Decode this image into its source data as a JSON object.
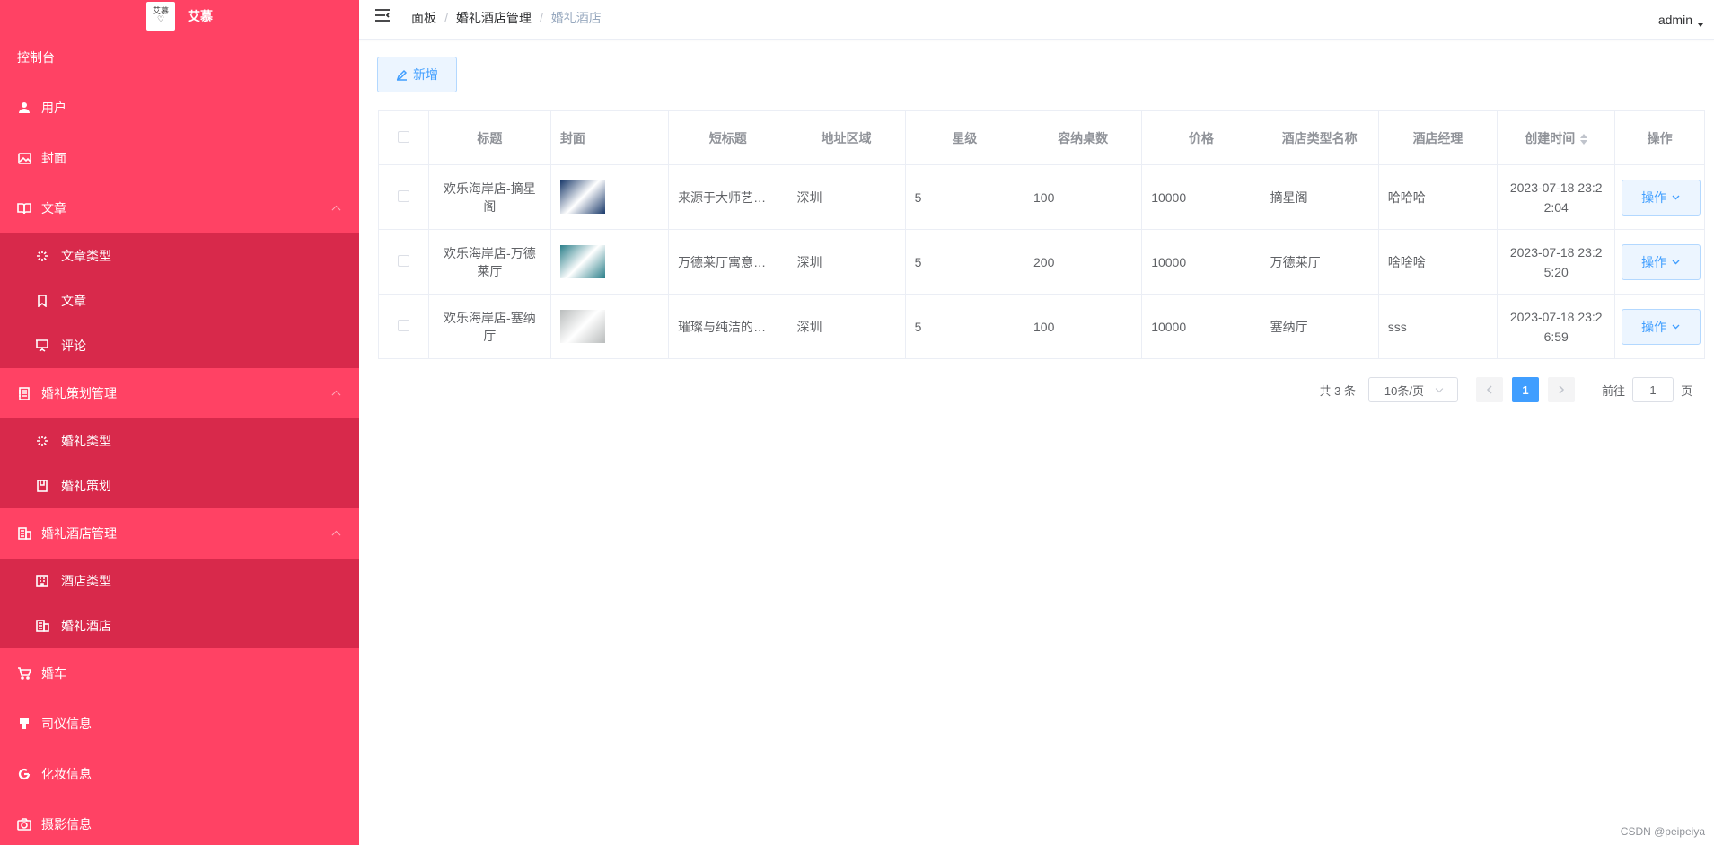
{
  "sidebar": {
    "logo_text": "艾慕",
    "logo_img_text": "艾慕 Aimu bride",
    "menu": {
      "dashboard": "控制台",
      "user": "用户",
      "cover": "封面",
      "article": "文章",
      "article_type": "文章类型",
      "article_sub": "文章",
      "comment": "评论",
      "wedding_plan_mgmt": "婚礼策划管理",
      "wedding_type": "婚礼类型",
      "wedding_plan": "婚礼策划",
      "hotel_mgmt": "婚礼酒店管理",
      "hotel_type": "酒店类型",
      "wedding_hotel": "婚礼酒店",
      "wedding_car": "婚车",
      "host_info": "司仪信息",
      "makeup_info": "化妆信息",
      "photo_info": "摄影信息"
    }
  },
  "header": {
    "breadcrumb": [
      "面板",
      "婚礼酒店管理",
      "婚礼酒店"
    ],
    "breadcrumb_sep": "/",
    "user": "admin"
  },
  "toolbar": {
    "add_label": "新增"
  },
  "table": {
    "columns": [
      "标题",
      "封面",
      "短标题",
      "地址区域",
      "星级",
      "容纳桌数",
      "价格",
      "酒店类型名称",
      "酒店经理",
      "创建时间",
      "操作"
    ],
    "rows": [
      {
        "title": "欢乐海岸店-摘星阁",
        "short": "来源于大师艺术家…",
        "area": "深圳",
        "star": "5",
        "tables": "100",
        "price": "10000",
        "type": "摘星阁",
        "manager": "哈哈哈",
        "created": "2023-07-18 23:22:04",
        "cover_color": "#1a3a6b"
      },
      {
        "title": "欢乐海岸店-万德莱厅",
        "short": "万德莱厅寓意：(…",
        "area": "深圳",
        "star": "5",
        "tables": "200",
        "price": "10000",
        "type": "万德莱厅",
        "manager": "啥啥啥",
        "created": "2023-07-18 23:25:20",
        "cover_color": "#2b7f8a"
      },
      {
        "title": "欢乐海岸店-塞纳厅",
        "short": "璀璨与纯洁的交汇…",
        "area": "深圳",
        "star": "5",
        "tables": "100",
        "price": "10000",
        "type": "塞纳厅",
        "manager": "sss",
        "created": "2023-07-18 23:26:59",
        "cover_color": "#b9bcbc"
      }
    ],
    "op_label": "操作"
  },
  "pagination": {
    "total": "共 3 条",
    "page_size": "10条/页",
    "current": "1",
    "goto_prefix": "前往",
    "goto_value": "1",
    "goto_suffix": "页"
  },
  "watermark": "CSDN @peipeiya",
  "colors": {
    "sidebar": "#ff4264",
    "submenu": "#d8294b",
    "primary": "#409eff"
  }
}
